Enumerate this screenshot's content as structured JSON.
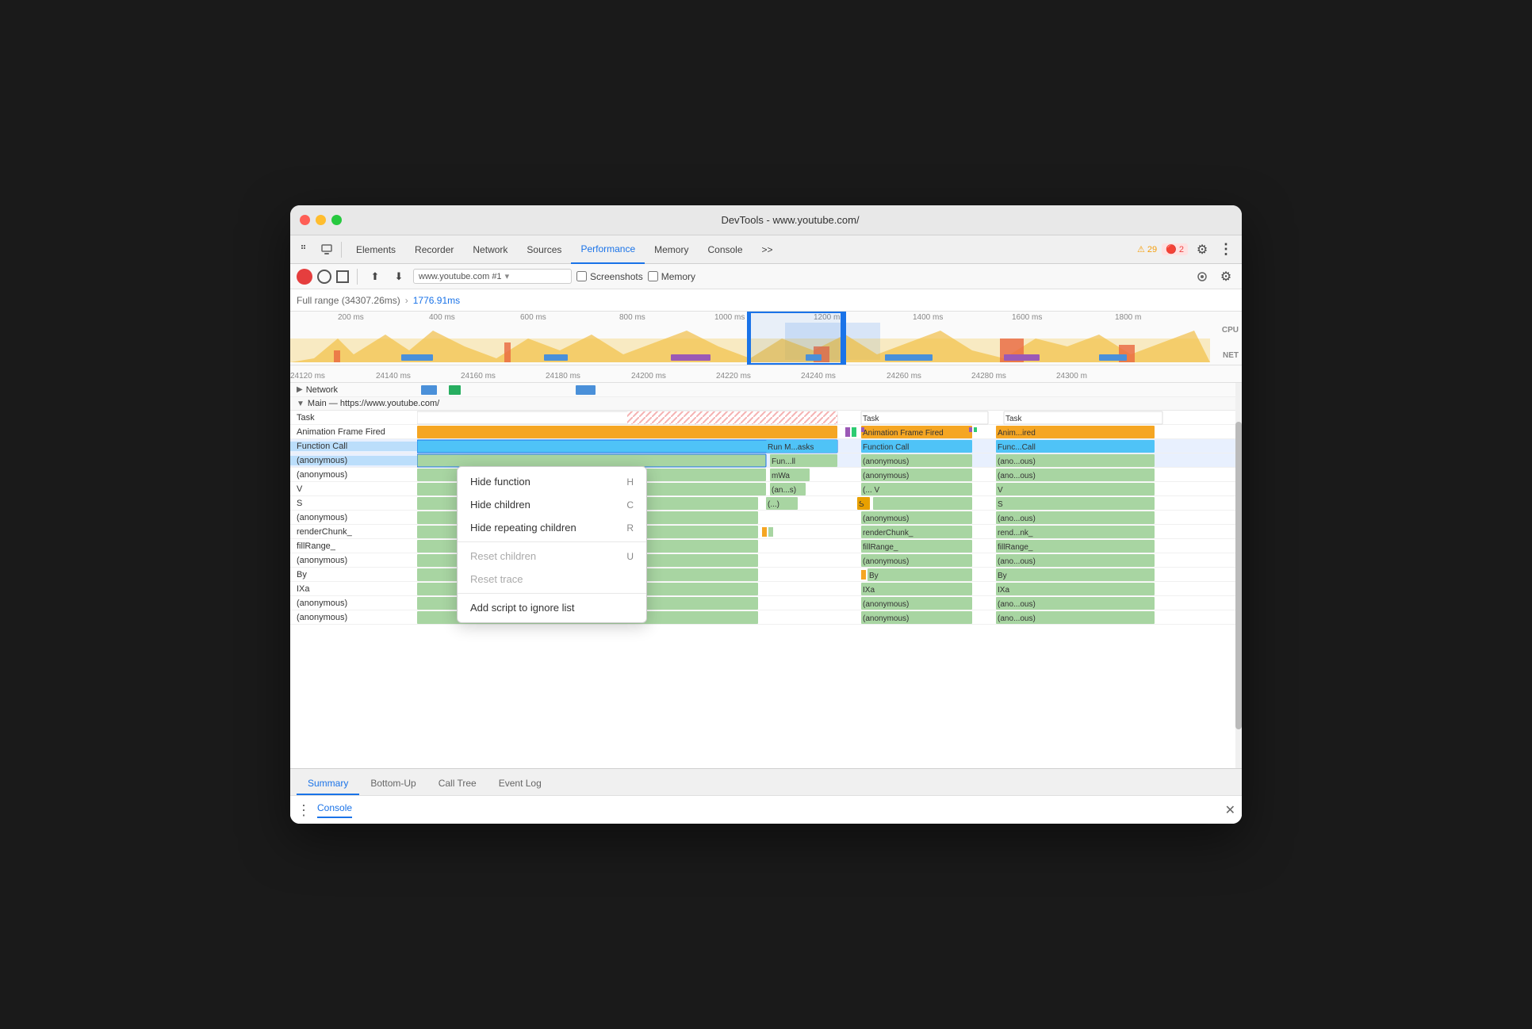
{
  "window": {
    "title": "DevTools - www.youtube.com/"
  },
  "toolbar": {
    "tabs": [
      "Elements",
      "Recorder",
      "Network",
      "Sources",
      "Performance",
      "Memory",
      "Console"
    ],
    "active_tab": "Performance",
    "more_label": ">>",
    "warning_count": "29",
    "error_count": "2",
    "settings_label": "⚙",
    "more_options_label": "⋮"
  },
  "record_bar": {
    "url": "www.youtube.com #1",
    "screenshots_label": "Screenshots",
    "memory_label": "Memory"
  },
  "range": {
    "full_range": "Full range (34307.26ms)",
    "arrow": "›",
    "selected": "1776.91ms"
  },
  "timeline_overview": {
    "ruler_ticks": [
      "200 ms",
      "400 ms",
      "600 ms",
      "800 ms",
      "1000 ms",
      "1200 ms",
      "1400 ms",
      "1600 ms",
      "1800 m"
    ],
    "cpu_label": "CPU",
    "net_label": "NET"
  },
  "timeline_detail": {
    "ruler_ticks": [
      "24120 ms",
      "24140 ms",
      "24160 ms",
      "24180 ms",
      "24200 ms",
      "24220 ms",
      "24240 ms",
      "24260 ms",
      "24280 ms",
      "24300 m"
    ],
    "network_label": "Network",
    "main_label": "Main — https://www.youtube.com/"
  },
  "flame_rows": [
    {
      "label": "Task",
      "color": "#fff",
      "has_red_block": true
    },
    {
      "label": "Animation Frame Fired",
      "color": "#f5a623"
    },
    {
      "label": "Function Call",
      "color": "#4fc3f7",
      "selected": true
    },
    {
      "label": "(anonymous)",
      "color": "#a8d5a2",
      "selected": true
    },
    {
      "label": "(anonymous)",
      "color": "#a8d5a2"
    },
    {
      "label": "V",
      "color": "#a8d5a2"
    },
    {
      "label": "S",
      "color": "#a8d5a2"
    },
    {
      "label": "(anonymous)",
      "color": "#a8d5a2"
    },
    {
      "label": "renderChunk_",
      "color": "#a8d5a2"
    },
    {
      "label": "fillRange_",
      "color": "#a8d5a2"
    },
    {
      "label": "(anonymous)",
      "color": "#a8d5a2"
    },
    {
      "label": "By",
      "color": "#a8d5a2"
    },
    {
      "label": "IXa",
      "color": "#a8d5a2"
    },
    {
      "label": "(anonymous)",
      "color": "#a8d5a2"
    },
    {
      "label": "(anonymous)",
      "color": "#a8d5a2"
    }
  ],
  "right_flame_rows": [
    {
      "label": "Task"
    },
    {
      "label": "Animation Frame Fired",
      "color": "#f5a623"
    },
    {
      "label": "Function Call",
      "color": "#4fc3f7"
    },
    {
      "label": "(anonymous)",
      "color": "#a8d5a2"
    },
    {
      "label": "(anonymous)",
      "color": "#a8d5a2"
    },
    {
      "label": "(... V",
      "color": "#a8d5a2"
    },
    {
      "label": "S",
      "color": "#e8a000"
    },
    {
      "label": "(anonymous)",
      "color": "#a8d5a2"
    },
    {
      "label": "renderChunk_",
      "color": "#a8d5a2"
    },
    {
      "label": "fillRange_",
      "color": "#a8d5a2"
    },
    {
      "label": "(anonymous)",
      "color": "#a8d5a2"
    },
    {
      "label": "By",
      "color": "#a8d5a2"
    },
    {
      "label": "IXa",
      "color": "#a8d5a2"
    },
    {
      "label": "(anonymous)",
      "color": "#a8d5a2"
    },
    {
      "label": "(anonymous)",
      "color": "#a8d5a2"
    }
  ],
  "far_right_rows": [
    {
      "label": "Task"
    },
    {
      "label": "Anim...ired",
      "color": "#f5a623"
    },
    {
      "label": "Func...Call",
      "color": "#4fc3f7"
    },
    {
      "label": "(ano...ous)",
      "color": "#a8d5a2"
    },
    {
      "label": "(ano...ous)",
      "color": "#a8d5a2"
    },
    {
      "label": "V",
      "color": "#a8d5a2"
    },
    {
      "label": "S",
      "color": "#a8d5a2"
    },
    {
      "label": "(ano...ous)",
      "color": "#a8d5a2"
    },
    {
      "label": "rend...nk_",
      "color": "#a8d5a2"
    },
    {
      "label": "fillRange_",
      "color": "#a8d5a2"
    },
    {
      "label": "(ano...ous)",
      "color": "#a8d5a2"
    },
    {
      "label": "By",
      "color": "#a8d5a2"
    },
    {
      "label": "IXa",
      "color": "#a8d5a2"
    },
    {
      "label": "(ano...ous)",
      "color": "#a8d5a2"
    },
    {
      "label": "(ano...ous)",
      "color": "#a8d5a2"
    }
  ],
  "middle_labels": [
    {
      "label": "Run M...asks"
    },
    {
      "label": "Fun...ll"
    },
    {
      "label": "mWa"
    },
    {
      "label": "(an...s)"
    },
    {
      "label": "(...)"
    }
  ],
  "context_menu": {
    "items": [
      {
        "label": "Hide function",
        "shortcut": "H",
        "disabled": false
      },
      {
        "label": "Hide children",
        "shortcut": "C",
        "disabled": false
      },
      {
        "label": "Hide repeating children",
        "shortcut": "R",
        "disabled": false
      },
      {
        "label": "Reset children",
        "shortcut": "U",
        "disabled": true
      },
      {
        "label": "Reset trace",
        "shortcut": "",
        "disabled": true
      },
      {
        "label": "Add script to ignore list",
        "shortcut": "",
        "disabled": false
      }
    ]
  },
  "bottom_tabs": [
    "Summary",
    "Bottom-Up",
    "Call Tree",
    "Event Log"
  ],
  "active_bottom_tab": "Summary",
  "console": {
    "dots": "⋮",
    "label": "Console",
    "close": "✕"
  }
}
